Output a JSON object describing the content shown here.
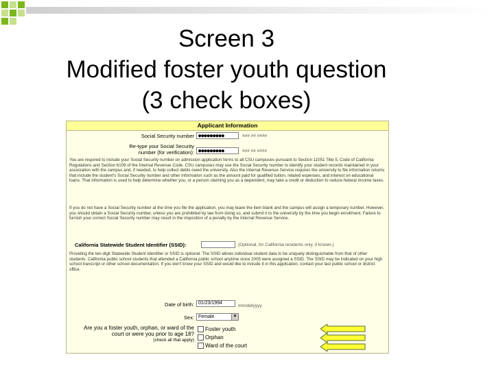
{
  "slide": {
    "title_lines": [
      "Screen 3",
      "Modified foster youth question",
      "(3 check boxes)"
    ],
    "accent_green": "#7cb61c",
    "accent_light": "#c7e08c"
  },
  "form": {
    "header": "Applicant Information",
    "ssn_label": "Social Security number",
    "ssn_value": "●●●●●●●●●",
    "ssn_hint": "### ## ####",
    "ssn_confirm_label_1": "Re-type your Social Security",
    "ssn_confirm_label_2": "number (for verification):",
    "ssn_confirm_value": "●●●●●●●●●",
    "ssn_confirm_hint": "### ## ####",
    "ssn_para": "You are required to include your Social Security number on admission application forms to all CSU campuses pursuant to Section 11051 Title 5, Code of California Regulations and Section 6109 of the Internal Revenue Code. CSU campuses may use the Social Security number to identify your student records maintained in your association with the campus and, if needed, to help collect debts owed the university. Also the Internal Revenue Service requires the university to file information returns that include the student's Social Security number and other information such as the amount paid for qualified tuition, related expenses, and interest on educational loans. That information is used to help determine whether you, or a person claiming you as a dependent, may take a credit or deduction to reduce federal income taxes.",
    "no_ssn_para": "If you do not have a Social Security number at the time you file the application, you may leave the item blank and the campus will assign a temporary number. However, you should obtain a Social Security number, unless you are prohibited by law from doing so, and submit it to the university by the time you begin enrollment. Failure to furnish your correct Social Security number may result in the imposition of a penalty by the Internal Revenue Service.",
    "ssid_label": "California Statewide Student Identifier (SSID):",
    "ssid_hint": "(Optional, for California residents only, if known.)",
    "ssid_para": "Providing the ten-digit Statewide Student Identifier or SSID is optional. The SSID allows individual student data to be uniquely distinguishable from that of other students. California public school students that attended a California public school anytime since 2005 were assigned a SSID. The SSID may be indicated on your high school transcript or other school documentation. If you don't know your SSID and would like to include it in this application, contact your last public school or district office.",
    "dob_label": "Date of birth:",
    "dob_value": "01/23/1994",
    "dob_hint": "mm/dd/yyyy",
    "sex_label": "Sex:",
    "sex_value": "Female",
    "foster_q1": "Are you a foster youth, orphan, or ward of the",
    "foster_q2": "court or were you prior to age 18?",
    "foster_note": "(check all that apply)",
    "options": [
      "Foster youth",
      "Orphan",
      "Ward of the court"
    ]
  }
}
